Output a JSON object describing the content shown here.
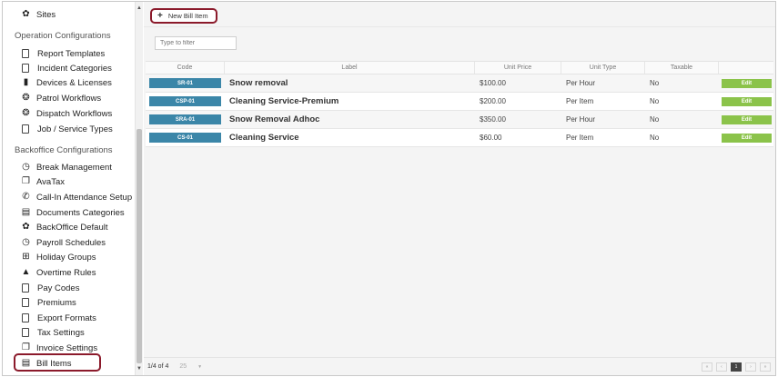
{
  "sidebar": {
    "top_item": {
      "label": "Sites",
      "icon": "gear-icon"
    },
    "sections": [
      {
        "label": "Operation Configurations",
        "items": [
          {
            "label": "Report Templates",
            "icon": "document-icon"
          },
          {
            "label": "Incident Categories",
            "icon": "document-icon"
          },
          {
            "label": "Devices & Licenses",
            "icon": "mobile-icon"
          },
          {
            "label": "Patrol Workflows",
            "icon": "cog-wheel-icon"
          },
          {
            "label": "Dispatch Workflows",
            "icon": "cog-wheel-icon"
          },
          {
            "label": "Job / Service Types",
            "icon": "document-icon"
          }
        ]
      },
      {
        "label": "Backoffice Configurations",
        "items": [
          {
            "label": "Break Management",
            "icon": "clock-icon"
          },
          {
            "label": "AvaTax",
            "icon": "copy-icon"
          },
          {
            "label": "Call-In Attendance Setup",
            "icon": "phone-icon"
          },
          {
            "label": "Documents Categories",
            "icon": "list-icon"
          },
          {
            "label": "BackOffice Default",
            "icon": "gear-icon"
          },
          {
            "label": "Payroll Schedules",
            "icon": "clock-icon"
          },
          {
            "label": "Holiday Groups",
            "icon": "gift-icon"
          },
          {
            "label": "Overtime Rules",
            "icon": "warning-icon"
          },
          {
            "label": "Pay Codes",
            "icon": "document-icon"
          },
          {
            "label": "Premiums",
            "icon": "document-icon"
          },
          {
            "label": "Export Formats",
            "icon": "document-icon"
          },
          {
            "label": "Tax Settings",
            "icon": "document-icon"
          },
          {
            "label": "Invoice Settings",
            "icon": "copy-icon"
          },
          {
            "label": "Bill Items",
            "icon": "list-icon"
          }
        ]
      }
    ]
  },
  "toolbar": {
    "new_label": "New Bill Item"
  },
  "filter": {
    "placeholder": "Type to filter"
  },
  "table": {
    "headers": {
      "code": "Code",
      "label": "Label",
      "price": "Unit Price",
      "unit": "Unit Type",
      "tax": "Taxable"
    },
    "edit_label": "Edit",
    "rows": [
      {
        "code": "SR-01",
        "label": "Snow removal",
        "price": "$100.00",
        "unit": "Per Hour",
        "tax": "No"
      },
      {
        "code": "CSP-01",
        "label": "Cleaning Service-Premium",
        "price": "$200.00",
        "unit": "Per Item",
        "tax": "No"
      },
      {
        "code": "SRA-01",
        "label": "Snow Removal Adhoc",
        "price": "$350.00",
        "unit": "Per Hour",
        "tax": "No"
      },
      {
        "code": "CS-01",
        "label": "Cleaning Service",
        "price": "$60.00",
        "unit": "Per Item",
        "tax": "No"
      }
    ]
  },
  "footer": {
    "page_info": "1/4 of 4",
    "page_size": "25",
    "current_page": "1"
  },
  "colors": {
    "accent": "#3b86a8",
    "edit": "#8bc34a",
    "highlight": "#8b1a2b"
  }
}
